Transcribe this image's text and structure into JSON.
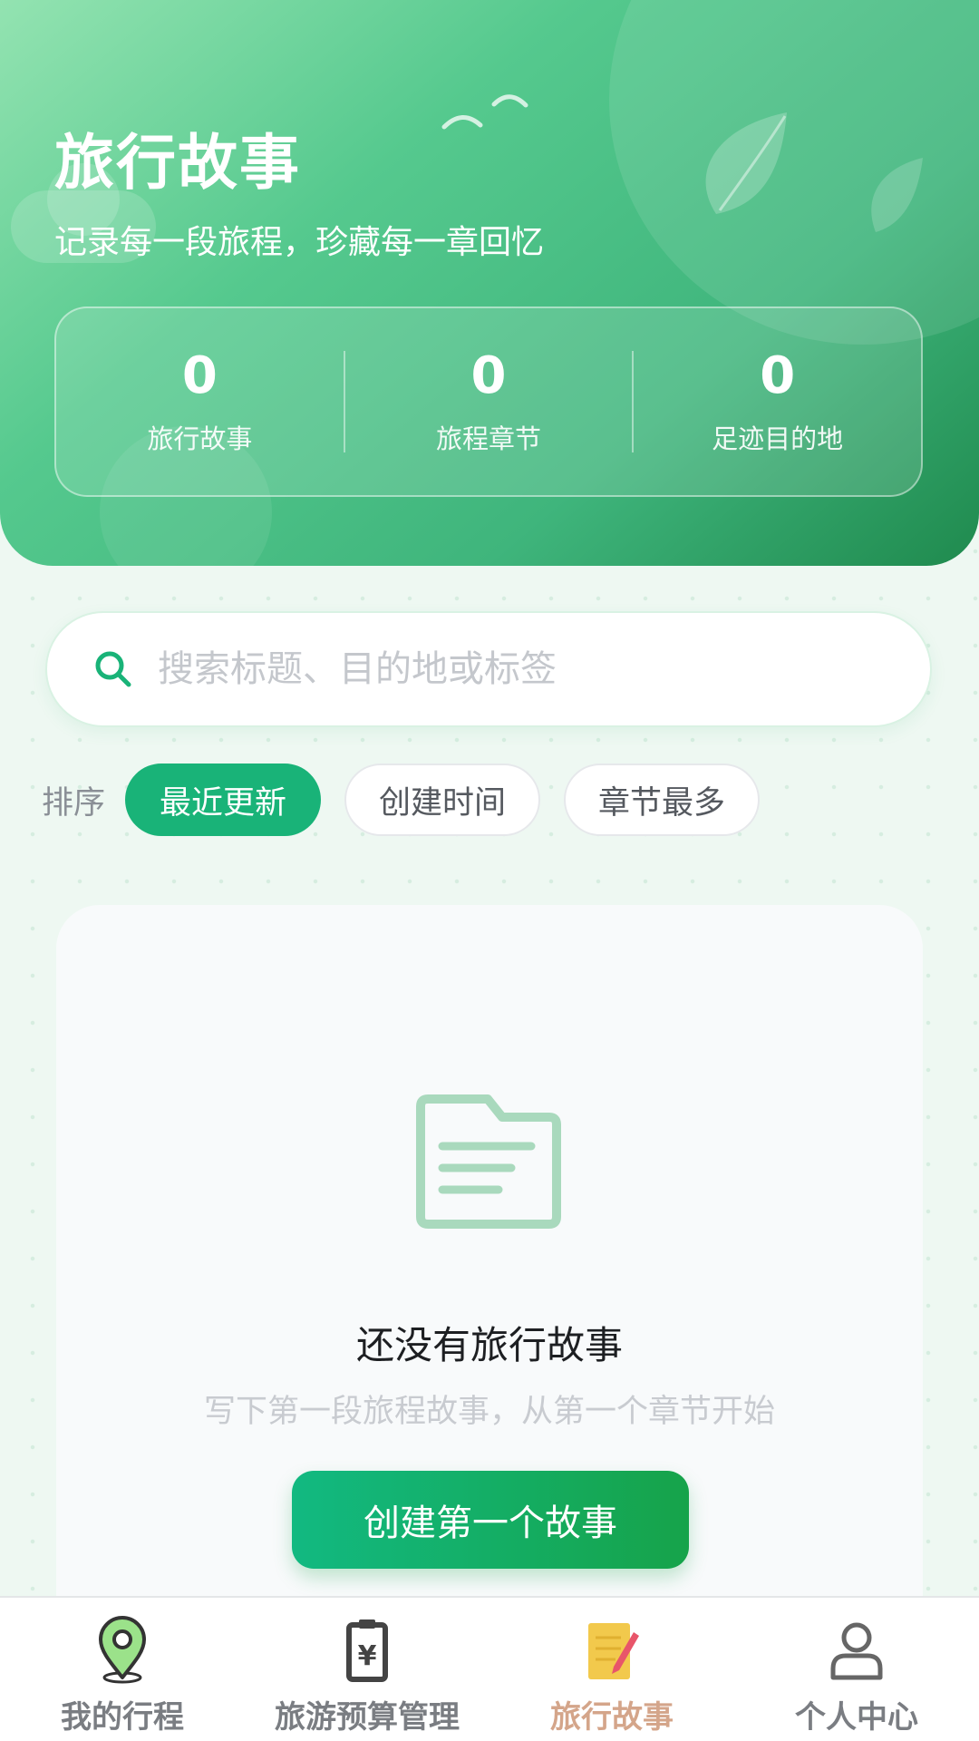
{
  "header": {
    "title": "旅行故事",
    "subtitle": "记录每一段旅程，珍藏每一章回忆"
  },
  "stats": [
    {
      "value": "0",
      "label": "旅行故事"
    },
    {
      "value": "0",
      "label": "旅程章节"
    },
    {
      "value": "0",
      "label": "足迹目的地"
    }
  ],
  "search": {
    "placeholder": "搜索标题、目的地或标签",
    "value": ""
  },
  "sort": {
    "label": "排序",
    "options": [
      {
        "label": "最近更新",
        "active": true
      },
      {
        "label": "创建时间",
        "active": false
      },
      {
        "label": "章节最多",
        "active": false
      }
    ]
  },
  "empty_state": {
    "icon": "folder-icon",
    "title": "还没有旅行故事",
    "description": "写下第一段旅程故事，从第一个章节开始",
    "button_label": "创建第一个故事"
  },
  "tabbar": {
    "items": [
      {
        "label": "我的行程",
        "icon": "map-pin-icon",
        "active": false
      },
      {
        "label": "旅游预算管理",
        "icon": "clipboard-icon",
        "active": false
      },
      {
        "label": "旅行故事",
        "icon": "notebook-pencil-icon",
        "active": true
      },
      {
        "label": "个人中心",
        "icon": "user-icon",
        "active": false
      }
    ]
  },
  "colors": {
    "accent": "#19b378",
    "header_gradient_start": "#93e3b1",
    "header_gradient_end": "#1f8a4e",
    "active_tab": "#d4a58a"
  }
}
